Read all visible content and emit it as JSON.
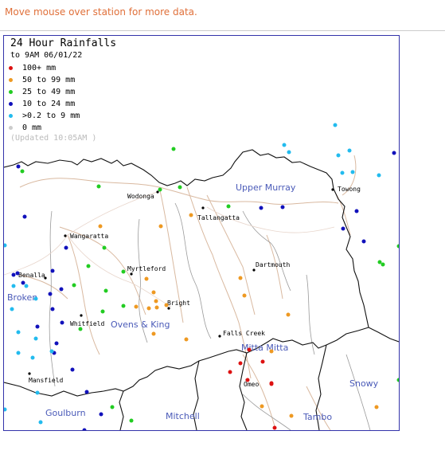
{
  "hint": "Move mouse over station for more data.",
  "legend": {
    "title": "24 Hour Rainfalls",
    "subtitle": "to 9AM 06/01/22",
    "updated": "(Updated 10:05AM  )",
    "items": [
      {
        "label": "100+ mm",
        "color": "#dd1111"
      },
      {
        "label": "50  to 99 mm",
        "color": "#ee9922"
      },
      {
        "label": "25  to 49 mm",
        "color": "#22cc22"
      },
      {
        "label": "10  to 24 mm",
        "color": "#1111bb"
      },
      {
        "label": ">0.2 to 9 mm",
        "color": "#22bbee"
      },
      {
        "label": "0 mm",
        "color": "#cccccc"
      }
    ]
  },
  "regions": [
    "Upper Murray",
    "Ovens & King",
    "Mitta Mitta",
    "Broken",
    "Snowy",
    "Goulburn",
    "Mitchell",
    "Tambo"
  ],
  "towns": [
    "Wodonga",
    "Towong",
    "Tallangatta",
    "Wangaratta",
    "Dartmouth",
    "Myrtleford",
    "Benalla",
    "Bright",
    "Whitfield",
    "Falls Creek",
    "Mansfield",
    "Omeo"
  ],
  "stations": {
    "red": 8,
    "orange": 19,
    "green": 20,
    "blue": 24,
    "cyan": 21
  }
}
